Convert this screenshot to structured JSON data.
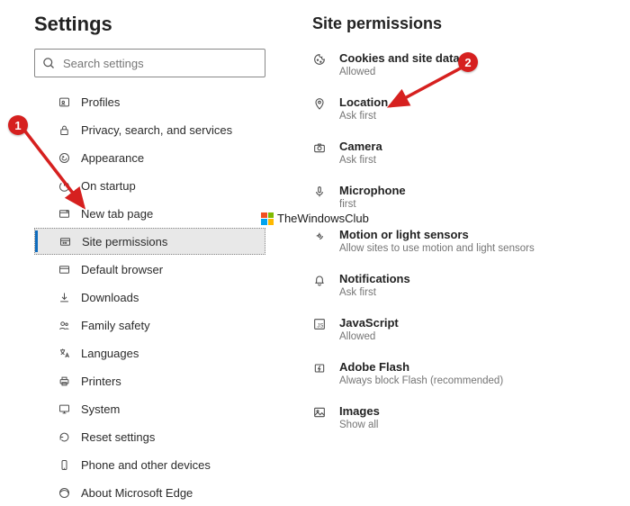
{
  "sidebar": {
    "title": "Settings",
    "search_placeholder": "Search settings",
    "items": [
      {
        "label": "Profiles"
      },
      {
        "label": "Privacy, search, and services"
      },
      {
        "label": "Appearance"
      },
      {
        "label": "On startup"
      },
      {
        "label": "New tab page"
      },
      {
        "label": "Site permissions"
      },
      {
        "label": "Default browser"
      },
      {
        "label": "Downloads"
      },
      {
        "label": "Family safety"
      },
      {
        "label": "Languages"
      },
      {
        "label": "Printers"
      },
      {
        "label": "System"
      },
      {
        "label": "Reset settings"
      },
      {
        "label": "Phone and other devices"
      },
      {
        "label": "About Microsoft Edge"
      }
    ]
  },
  "main": {
    "title": "Site permissions",
    "items": [
      {
        "title": "Cookies and site data",
        "sub": "Allowed"
      },
      {
        "title": "Location",
        "sub": "Ask first"
      },
      {
        "title": "Camera",
        "sub": "Ask first"
      },
      {
        "title": "Microphone",
        "sub": "first"
      },
      {
        "title": "Motion or light sensors",
        "sub": "Allow sites to use motion and light sensors"
      },
      {
        "title": "Notifications",
        "sub": "Ask first"
      },
      {
        "title": "JavaScript",
        "sub": "Allowed"
      },
      {
        "title": "Adobe Flash",
        "sub": "Always block Flash (recommended)"
      },
      {
        "title": "Images",
        "sub": "Show all"
      }
    ]
  },
  "annotations": {
    "badge1": "1",
    "badge2": "2",
    "watermark": "TheWindowsClub"
  }
}
